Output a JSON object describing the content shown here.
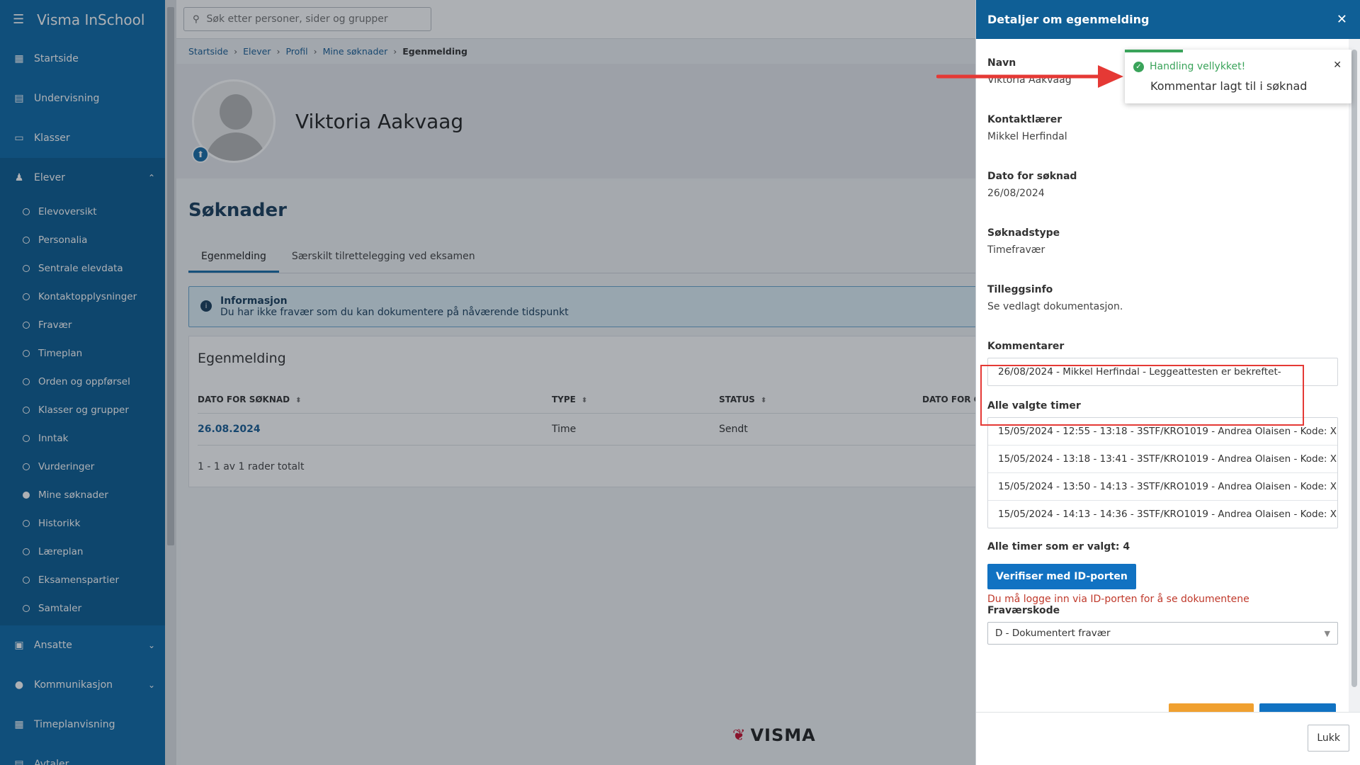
{
  "app": {
    "title": "Visma InSchool"
  },
  "search": {
    "placeholder": "Søk etter personer, sider og grupper"
  },
  "sidebar": {
    "items": [
      {
        "label": "Startside",
        "icon": "dashboard-icon"
      },
      {
        "label": "Undervisning",
        "icon": "book-icon"
      },
      {
        "label": "Klasser",
        "icon": "classroom-icon"
      },
      {
        "label": "Elever",
        "icon": "student-icon"
      }
    ],
    "elever_sub": [
      "Elevoversikt",
      "Personalia",
      "Sentrale elevdata",
      "Kontaktopplysninger",
      "Fravær",
      "Timeplan",
      "Orden og oppførsel",
      "Klasser og grupper",
      "Inntak",
      "Vurderinger",
      "Mine søknader",
      "Historikk",
      "Læreplan",
      "Eksamenspartier",
      "Samtaler"
    ],
    "bottom_items": [
      {
        "label": "Ansatte",
        "icon": "briefcase-icon"
      },
      {
        "label": "Kommunikasjon",
        "icon": "chat-icon"
      },
      {
        "label": "Timeplanvisning",
        "icon": "calendar-icon"
      },
      {
        "label": "Avtaler",
        "icon": "agreement-icon"
      }
    ]
  },
  "breadcrumb": [
    "Startside",
    "Elever",
    "Profil",
    "Mine søknader",
    "Egenmelding"
  ],
  "profile": {
    "name": "Viktoria Aakvaag"
  },
  "main": {
    "section_title": "Søknader",
    "tabs": [
      "Egenmelding",
      "Særskilt tilrettelegging ved eksamen"
    ],
    "info": {
      "title": "Informasjon",
      "text": "Du har ikke fravær som du kan dokumentere på nåværende tidspunkt"
    },
    "card_title": "Egenmelding",
    "table": {
      "headers": [
        "DATO FOR SØKNAD",
        "TYPE",
        "STATUS",
        "DATO FOR G"
      ],
      "rows": [
        {
          "date": "26.08.2024",
          "type": "Time",
          "status": "Sendt"
        }
      ],
      "total": "1 - 1 av 1 rader totalt"
    },
    "footer_logo": "VISMA"
  },
  "drawer": {
    "title": "Detaljer om egenmelding",
    "fields": {
      "navn": {
        "label": "Navn",
        "value": "Viktoria Aakvaag"
      },
      "kontaktlaerer": {
        "label": "Kontaktlærer",
        "value": "Mikkel Herfindal"
      },
      "dato": {
        "label": "Dato for søknad",
        "value": "26/08/2024"
      },
      "type": {
        "label": "Søknadstype",
        "value": "Timefravær"
      },
      "tillegg": {
        "label": "Tilleggsinfo",
        "value": "Se vedlagt dokumentasjon."
      }
    },
    "comments": {
      "label": "Kommentarer",
      "items": [
        "26/08/2024 - Mikkel Herfindal - Leggeattesten er bekreftet-"
      ]
    },
    "timer": {
      "label": "Alle valgte timer",
      "items": [
        "15/05/2024 - 12:55 - 13:18 - 3STF/KRO1019 - Andrea Olaisen - Kode: X",
        "15/05/2024 - 13:18 - 13:41 - 3STF/KRO1019 - Andrea Olaisen - Kode: X",
        "15/05/2024 - 13:50 - 14:13 - 3STF/KRO1019 - Andrea Olaisen - Kode: X",
        "15/05/2024 - 14:13 - 14:36 - 3STF/KRO1019 - Andrea Olaisen - Kode: X"
      ],
      "total": "Alle timer som er valgt: 4"
    },
    "verify_button": "Verifiser med ID-porten",
    "error": "Du må logge inn via ID-porten for å se dokumentene",
    "fravaerskode": {
      "label": "Fraværskode",
      "value": "D - Dokumentert fravær"
    },
    "close_button": "Lukk"
  },
  "toast": {
    "title": "Handling vellykket!",
    "message": "Kommentar lagt til i søknad"
  },
  "colors": {
    "sidebar": "#0f6aa8",
    "header": "#0f5f96",
    "primary": "#1172c2",
    "success": "#3aa35a",
    "error": "#c0392b",
    "annotation": "#e53935"
  }
}
